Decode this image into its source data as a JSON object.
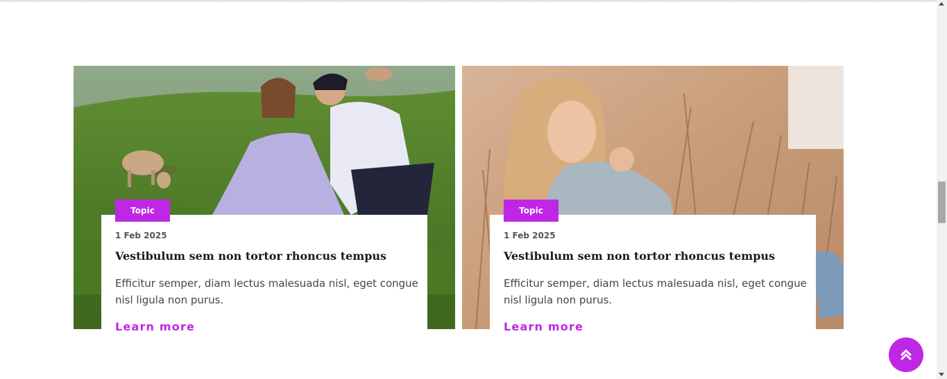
{
  "cards": [
    {
      "image_alt": "couple sitting on grassy hillside with goats",
      "topic": "Topic",
      "date": "1 Feb 2025",
      "title": "Vestibulum sem non tortor rhoncus tempus",
      "excerpt": "Efficitur semper, diam lectus malesuada nisl, eget congue nisl ligula non purus.",
      "link": "Learn more"
    },
    {
      "image_alt": "blonde woman sitting in dry grass",
      "topic": "Topic",
      "date": "1 Feb 2025",
      "title": "Vestibulum sem non tortor rhoncus tempus",
      "excerpt": "Efficitur semper, diam lectus malesuada nisl, eget congue nisl ligula non purus.",
      "link": "Learn more"
    }
  ],
  "back_to_top": {
    "icon": "double-chevron-up-icon"
  },
  "colors": {
    "accent": "#c026e6"
  }
}
